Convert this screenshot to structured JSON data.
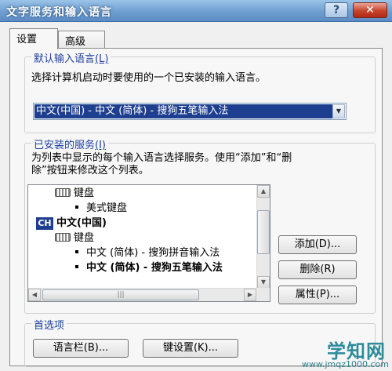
{
  "window": {
    "title": "文字服务和输入语言"
  },
  "tabs": [
    {
      "label": "设置"
    },
    {
      "label": "高级"
    }
  ],
  "default_language": {
    "legend": "默认输入语言",
    "legend_key": "(L)",
    "description": "选择计算机启动时要使用的一个已安装的输入语言。",
    "selected": "中文(中国) - 中文 (简体) - 搜狗五笔输入法"
  },
  "installed_services": {
    "legend": "已安装的服务",
    "legend_key": "(I)",
    "description_line1": "为列表中显示的每个输入语言选择服务。使用“添加”和“删",
    "description_line2": "除”按钮来修改这个列表。",
    "tree": [
      {
        "text": "键盘"
      },
      {
        "text": "美式键盘"
      },
      {
        "badge": "CH",
        "text": "中文(中国)"
      },
      {
        "text": "键盘"
      },
      {
        "text": "中文 (简体) - 搜狗拼音输入法"
      },
      {
        "text": "中文 (简体) - 搜狗五笔输入法"
      }
    ],
    "buttons": {
      "add": "添加(D)...",
      "remove": "删除(R)",
      "properties": "属性(P)..."
    }
  },
  "preferences": {
    "legend": "首选项",
    "language_bar": "语言栏(B)...",
    "key_settings": "键设置(K)..."
  },
  "watermark": {
    "title": "学知网",
    "url": "www.jmqz1000.com"
  },
  "colors": {
    "selection": "#1e3f8f",
    "legend_text": "#1d3fa0",
    "title_bar": "#6f9ed0",
    "close_button": "#c7432a"
  },
  "icons": [
    "help-icon",
    "close-icon",
    "keyboard-icon",
    "dropdown-arrow-icon",
    "scroll-up-icon",
    "scroll-down-icon",
    "scroll-left-icon",
    "scroll-right-icon"
  ]
}
